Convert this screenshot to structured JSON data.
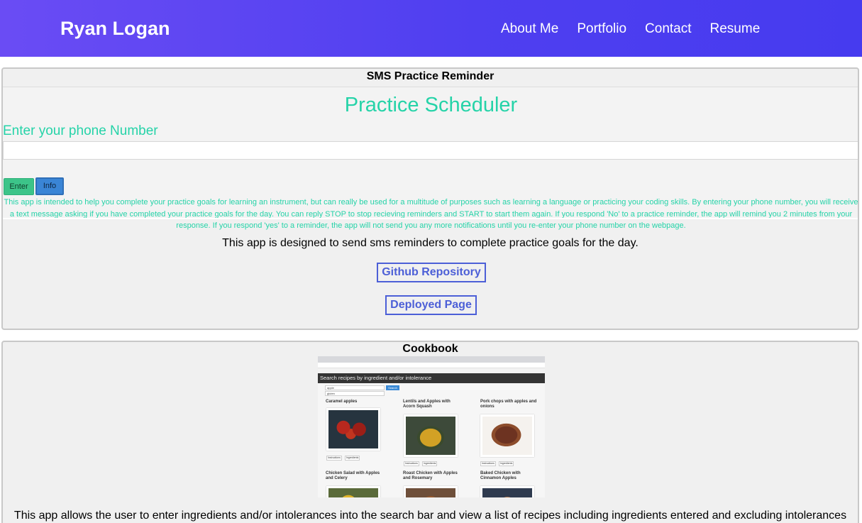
{
  "nav": {
    "brand": "Ryan Logan",
    "links": [
      "About Me",
      "Portfolio",
      "Contact",
      "Resume"
    ]
  },
  "projects": [
    {
      "title": "SMS Practice Reminder",
      "screenshot": {
        "heading": "Practice Scheduler",
        "label": "Enter your phone Number",
        "enter_button": "Enter",
        "info_button": "Info",
        "description": "This app is intended to help you complete your practice goals for learning an instrument, but can really be used for a multitude of purposes such as learning a language or practicing your coding skills. By entering your phone number, you will receive a text message asking if you have completed your practice goals for the day. You can reply STOP to stop recieving reminders and START to start them again. If you respond 'No' to a practice reminder, the app will remind you 2 minutes from your response. If you respond 'yes' to a reminder, the app will not send you any more notifications until you re-enter your phone number on the webpage.",
        "accent_color": "#25d3a8"
      },
      "description": "This app is designed to send sms reminders to complete practice goals for the day.",
      "github_link": "Github Repository",
      "deployed_link": "Deployed Page"
    },
    {
      "title": "Cookbook",
      "screenshot": {
        "header": "Search recipes by ingredient and/or intolerance",
        "search_value": "apple",
        "search_button": "Search",
        "intolerance_value": "gluten",
        "instructions_label": "Instructions",
        "ingredients_label": "Ingredients",
        "recipes": [
          "Caramel apples",
          "Lentils and Apples with Acorn Squash",
          "Pork chops with apples and onions",
          "Chicken Salad with Apples and Celery",
          "Roast Chicken with Apples and Rosemary",
          "Baked Chicken with Cinnamon Apples"
        ]
      },
      "description": "This app allows the user to enter ingredients and/or intolerances into the search bar and view a list of recipes including ingredients entered and excluding intolerances"
    }
  ],
  "colors": {
    "navbar_gradient": [
      "#6a4cf4",
      "#463bef"
    ],
    "link_border": "#4c5fd7",
    "card_background": "#f0f0f0"
  }
}
